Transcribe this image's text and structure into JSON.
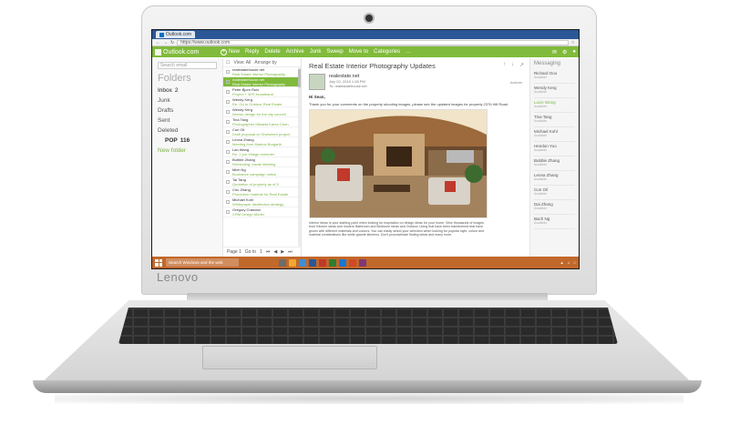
{
  "device": {
    "brand": "Lenovo"
  },
  "browser": {
    "tab_label": "Outlook.com",
    "url": "https://www.outlook.com"
  },
  "app_bar": {
    "logo": "Outlook.com",
    "commands": [
      "New",
      "Reply",
      "Delete",
      "Archive",
      "Junk",
      "Sweep",
      "Move to",
      "Categories",
      "…"
    ]
  },
  "folders": {
    "search_placeholder": "Search email",
    "title": "Folders",
    "items": [
      {
        "label": "Inbox",
        "count": "2"
      },
      {
        "label": "Junk",
        "count": ""
      },
      {
        "label": "Drafts",
        "count": ""
      },
      {
        "label": "Sent",
        "count": ""
      },
      {
        "label": "Deleted",
        "count": ""
      }
    ],
    "sub_item": {
      "label": "POP",
      "count": "116"
    },
    "new_folder": "New folder"
  },
  "message_list": {
    "view_label": "View: All",
    "arrange_label": "Arrange by",
    "messages": [
      {
        "from": "realestatehouse.net",
        "subject": "Real Estate Interior Photography"
      },
      {
        "from": "realestatehouse.net",
        "subject": "Real Estate Interior Photography",
        "selected": true
      },
      {
        "from": "Peter Bjorn Ruiz",
        "subject": "Project + 3PS broadband"
      },
      {
        "from": "Wendy Kerg",
        "subject": "Re: Go to Outdoor Real Estate"
      },
      {
        "from": "Wendy Kerg",
        "subject": "Interior design for the city council"
      },
      {
        "from": "Tina Tang",
        "subject": "Photographer Mikaela Karen Chen"
      },
      {
        "from": "Cun Oil",
        "subject": "Draft proposal on Shenzhen project"
      },
      {
        "from": "Leona Zhang",
        "subject": "Meeting from Markus Borgarth"
      },
      {
        "from": "Lan Wang",
        "subject": "Re: 2 pm Village reminder"
      },
      {
        "from": "Bubble Zhang",
        "subject": "Reminding: Inside Meeting"
      },
      {
        "from": "Mich Ng",
        "subject": "Bookstore campaign notice"
      },
      {
        "from": "Tai Tang",
        "subject": "Quotation of property as of 5"
      },
      {
        "from": "Cho Zhang",
        "subject": "Promotion material for Real Estate"
      },
      {
        "from": "Michael Kohl",
        "subject": "Whitepaper distribution strategy"
      },
      {
        "from": "Gregory Crandon",
        "subject": "CRM Design Model"
      }
    ],
    "pager": {
      "page_label": "Page 1",
      "goto_label": "Go to",
      "page_input": "1"
    }
  },
  "reading_pane": {
    "subject": "Real Estate Interior Photography Updates",
    "sender_name": "realestate.net",
    "sender_date": "July 02, 2015 1:28 PM",
    "sender_to": "To: realestatehouse.net",
    "actions_label": "Actions",
    "greeting": "Hi Sean,",
    "intro": "Thank you for your comments on the property shooting images, please see the updated images for property 2376 Hill Road.",
    "body": "Interior Ideas is your starting point when looking for inspiration on design ideas for your home. View thousands of images from Kitchen ideas and modern Bathroom and Bedroom Ideas and Outdoor Living that have been transformed that have grown with different materials and colours. You can easily select your selection when looking for popular style, colour and material combinations like white granite kitchens. Don't procrastinate finding ideas and many more."
  },
  "messaging": {
    "title": "Messaging",
    "contacts": [
      {
        "name": "Richard Ooo",
        "status": "Available"
      },
      {
        "name": "Wendy Kerg",
        "status": "Available"
      },
      {
        "name": "Lucie Wong",
        "status": "Available",
        "highlight": true
      },
      {
        "name": "Tina Tang",
        "status": "Available"
      },
      {
        "name": "Michael Kohl",
        "status": "Available"
      },
      {
        "name": "Hendon Yuo",
        "status": "Available"
      },
      {
        "name": "Bubble Zhang",
        "status": "Available"
      },
      {
        "name": "Leona Zhang",
        "status": "Available"
      },
      {
        "name": "Cun Oil",
        "status": "Available"
      },
      {
        "name": "Dai Zhang",
        "status": "Available"
      },
      {
        "name": "Bach Ng",
        "status": "Available"
      }
    ]
  },
  "taskbar": {
    "search_placeholder": "Search Windows and the web",
    "app_colors": [
      "#6d6d6d",
      "#f0a830",
      "#3b8edb",
      "#2b5797",
      "#c0392b",
      "#2e7d32",
      "#1976d2",
      "#d24726",
      "#7e3878"
    ]
  },
  "colors": {
    "accent": "#80bb3b",
    "taskbar": "#c1682b",
    "browser": "#2b5797"
  }
}
